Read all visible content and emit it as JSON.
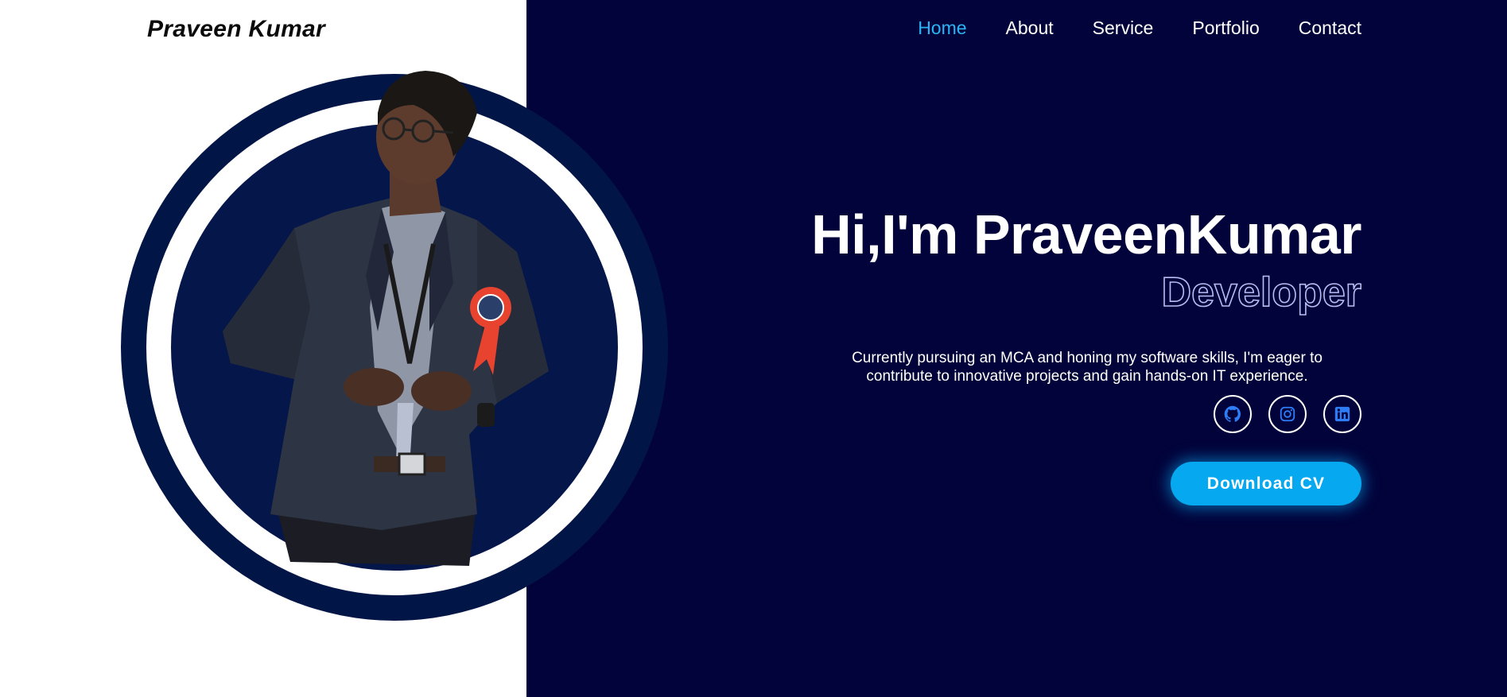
{
  "brand": "Praveen Kumar",
  "nav": {
    "items": [
      "Home",
      "About",
      "Service",
      "Portfolio",
      "Contact"
    ],
    "active": "Home"
  },
  "hero": {
    "headline": "Hi,I'm PraveenKumar",
    "role": "Developer",
    "bio": "Currently pursuing an MCA and honing my software skills, I'm eager to contribute to innovative projects and gain hands-on IT experience.",
    "cta_label": "Download CV"
  },
  "socials": [
    {
      "icon": "github-icon"
    },
    {
      "icon": "instagram-icon"
    },
    {
      "icon": "linkedin-icon"
    }
  ],
  "colors": {
    "background_dark": "#02033a",
    "background_light": "#ffffff",
    "circle_navy": "#021547",
    "accent_blue": "#06a8f0",
    "nav_active": "#2bb5f5"
  }
}
